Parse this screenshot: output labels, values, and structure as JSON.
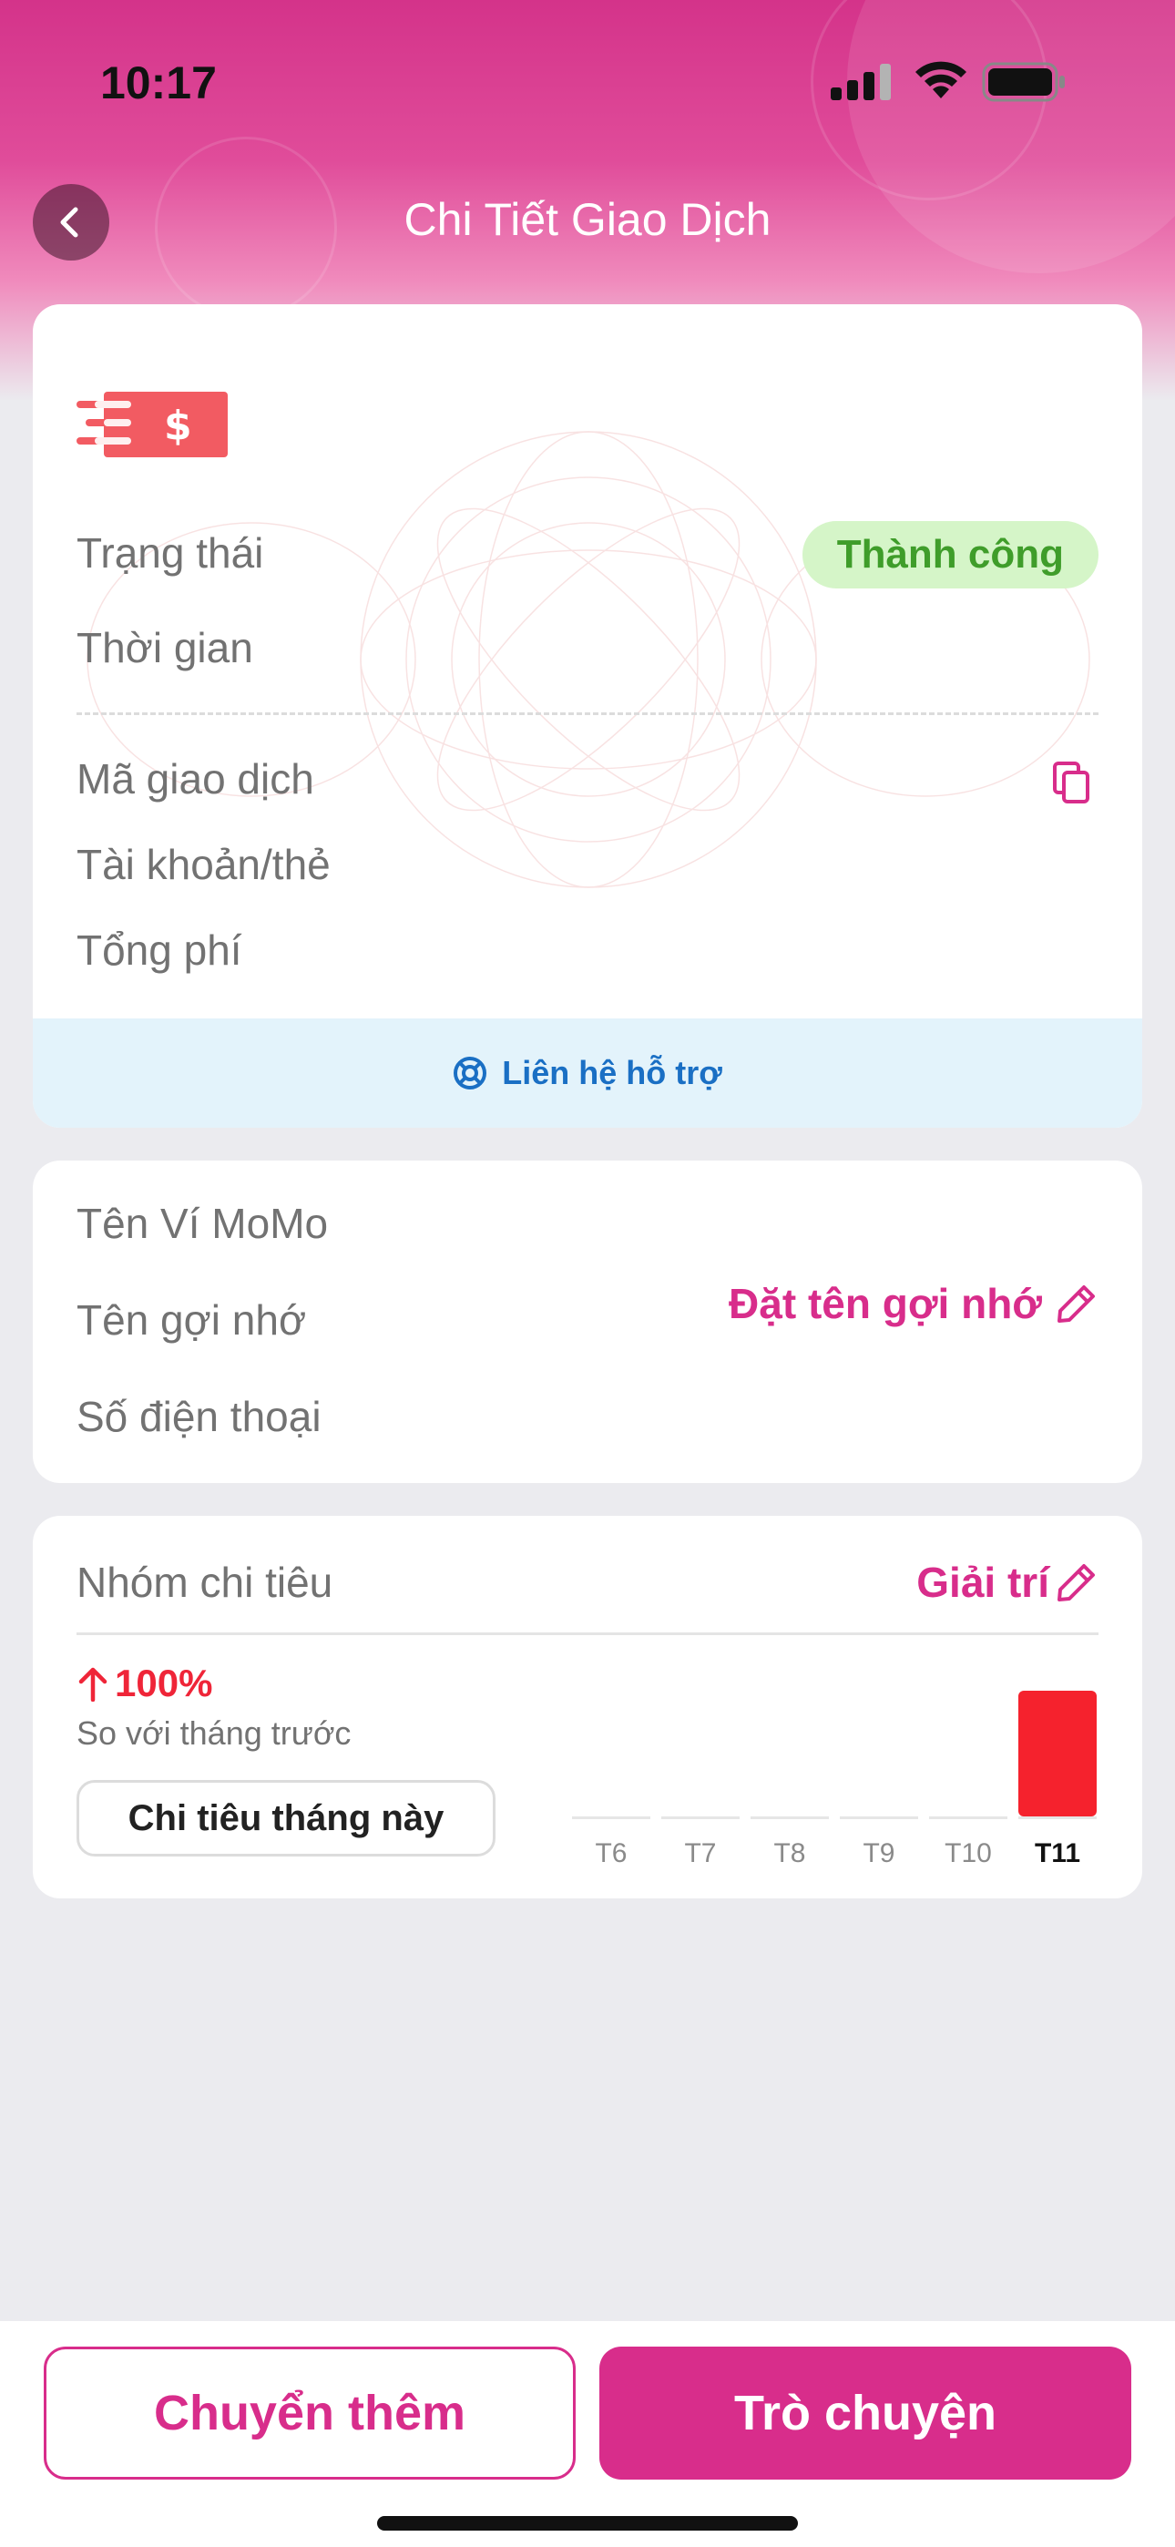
{
  "status_bar": {
    "time": "10:17"
  },
  "header": {
    "title": "Chi Tiết Giao Dịch"
  },
  "transaction": {
    "status_label": "Trạng thái",
    "status_value": "Thành công",
    "time_label": "Thời gian",
    "transaction_id_label": "Mã giao dịch",
    "account_label": "Tài khoản/thẻ",
    "fee_label": "Tổng phí",
    "support_label": "Liên hệ hỗ trợ"
  },
  "recipient": {
    "wallet_name_label": "Tên Ví MoMo",
    "nickname_label": "Tên gợi nhớ",
    "nickname_action": "Đặt tên gợi nhớ",
    "phone_label": "Số điện thoại"
  },
  "spending": {
    "group_label": "Nhóm chi tiêu",
    "group_value": "Giải trí",
    "change_value": "100%",
    "compare_label": "So với tháng trước",
    "month_button": "Chi tiêu tháng này"
  },
  "chart_data": {
    "type": "bar",
    "categories": [
      "T6",
      "T7",
      "T8",
      "T9",
      "T10",
      "T11"
    ],
    "values": [
      0,
      0,
      0,
      0,
      0,
      1
    ],
    "highlight": "T11",
    "colors": {
      "bar": "#f5222d",
      "baseline": "#e6e6e6"
    }
  },
  "actions": {
    "secondary_label": "Chuyển thêm",
    "primary_label": "Trò chuyện"
  },
  "colors": {
    "brand": "#d82d8b",
    "success_bg": "#d5f5c8",
    "success_text": "#3f9d2a",
    "link_blue": "#1a6fc4",
    "increase_red": "#ef2538"
  }
}
